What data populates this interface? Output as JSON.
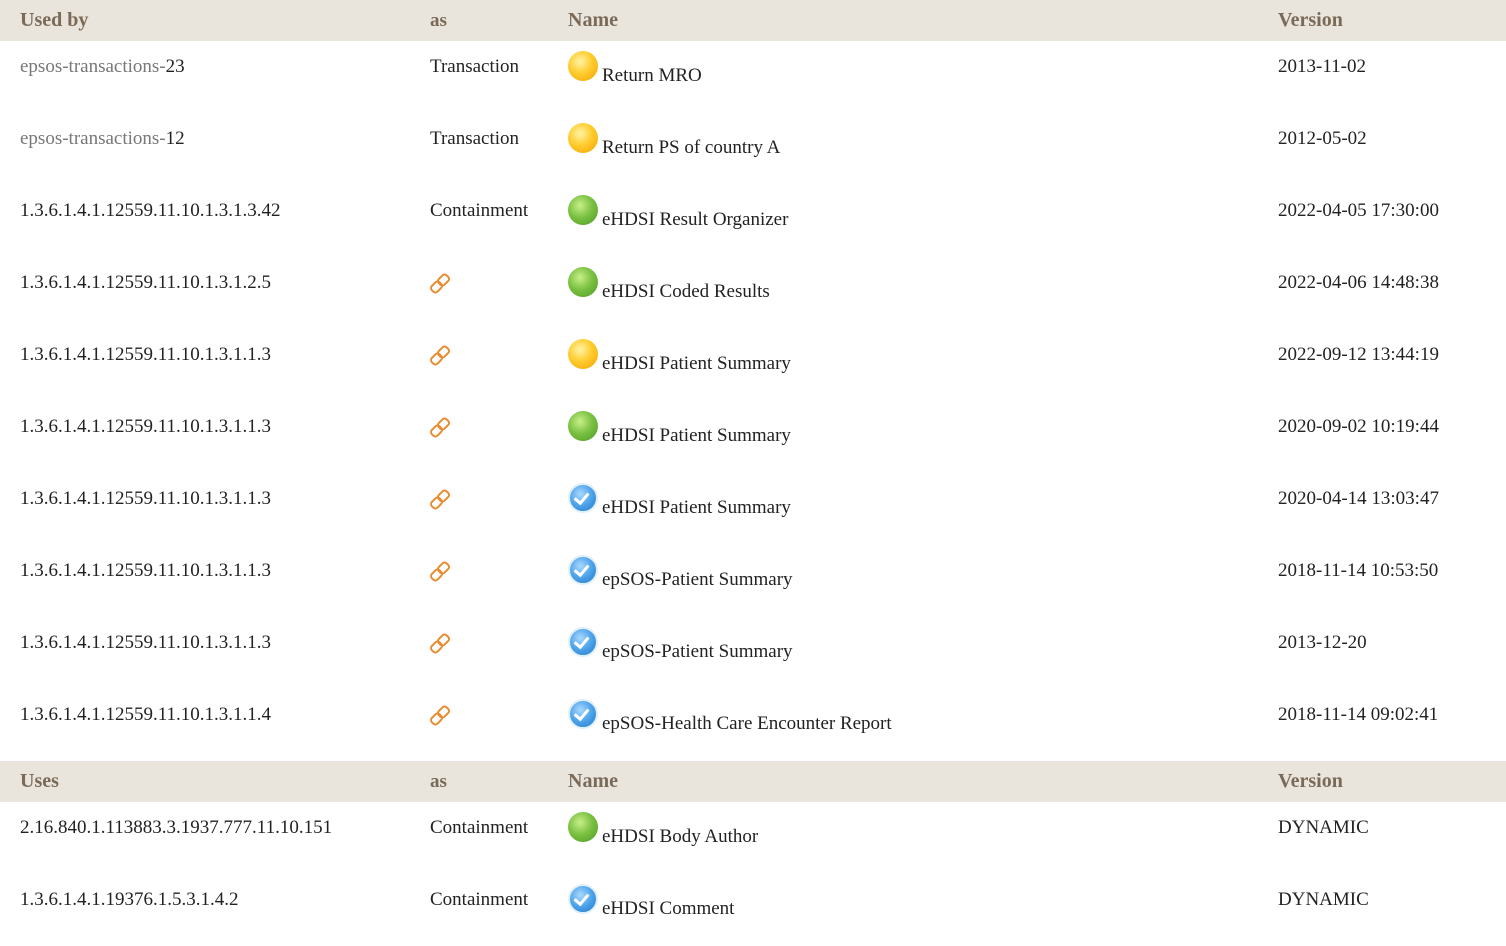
{
  "header1": {
    "used_by": "Used by",
    "as": "as",
    "name": "Name",
    "version": "Version"
  },
  "used_by_rows": [
    {
      "id_prefix": "epsos-transactions-",
      "id_num": "23",
      "as": "Transaction",
      "status": "draft",
      "name": "Return MRO",
      "version": "2013-11-02"
    },
    {
      "id_prefix": "epsos-transactions-",
      "id_num": "12",
      "as": "Transaction",
      "status": "draft",
      "name": "Return PS of country A",
      "version": "2012-05-02"
    },
    {
      "id": "1.3.6.1.4.1.12559.11.10.1.3.1.3.42",
      "as": "Containment",
      "status": "active",
      "name": "eHDSI Result Organizer",
      "version": "2022-04-05 17:30:00"
    },
    {
      "id": "1.3.6.1.4.1.12559.11.10.1.3.1.2.5",
      "as_icon": "link-icon",
      "status": "active",
      "name": "eHDSI Coded Results",
      "version": "2022-04-06 14:48:38"
    },
    {
      "id": "1.3.6.1.4.1.12559.11.10.1.3.1.1.3",
      "as_icon": "link-icon",
      "status": "draft",
      "name": "eHDSI Patient Summary",
      "version": "2022-09-12 13:44:19"
    },
    {
      "id": "1.3.6.1.4.1.12559.11.10.1.3.1.1.3",
      "as_icon": "link-icon",
      "status": "active",
      "name": "eHDSI Patient Summary",
      "version": "2020-09-02 10:19:44"
    },
    {
      "id": "1.3.6.1.4.1.12559.11.10.1.3.1.1.3",
      "as_icon": "link-icon",
      "status": "final",
      "name": "eHDSI Patient Summary",
      "version": "2020-04-14 13:03:47"
    },
    {
      "id": "1.3.6.1.4.1.12559.11.10.1.3.1.1.3",
      "as_icon": "link-icon",
      "status": "final",
      "name": "epSOS-Patient Summary",
      "version": "2018-11-14 10:53:50"
    },
    {
      "id": "1.3.6.1.4.1.12559.11.10.1.3.1.1.3",
      "as_icon": "link-icon",
      "status": "final",
      "name": "epSOS-Patient Summary",
      "version": "2013-12-20"
    },
    {
      "id": "1.3.6.1.4.1.12559.11.10.1.3.1.1.4",
      "as_icon": "link-icon",
      "status": "final",
      "name": "epSOS-Health Care Encounter Report",
      "version": "2018-11-14 09:02:41"
    }
  ],
  "header2": {
    "uses": "Uses",
    "as": "as",
    "name": "Name",
    "version": "Version"
  },
  "uses_rows": [
    {
      "id": "2.16.840.1.113883.3.1937.777.11.10.151",
      "as": "Containment",
      "status": "active",
      "name": "eHDSI Body Author",
      "version": "DYNAMIC"
    },
    {
      "id": "1.3.6.1.4.1.19376.1.5.3.1.4.2",
      "as": "Containment",
      "status": "final",
      "name": "eHDSI Comment",
      "version": "DYNAMIC"
    }
  ],
  "colors": {
    "header_bg": "#e9e4dc",
    "header_text": "#7a6a57",
    "link_icon": "#ea8a2f"
  }
}
